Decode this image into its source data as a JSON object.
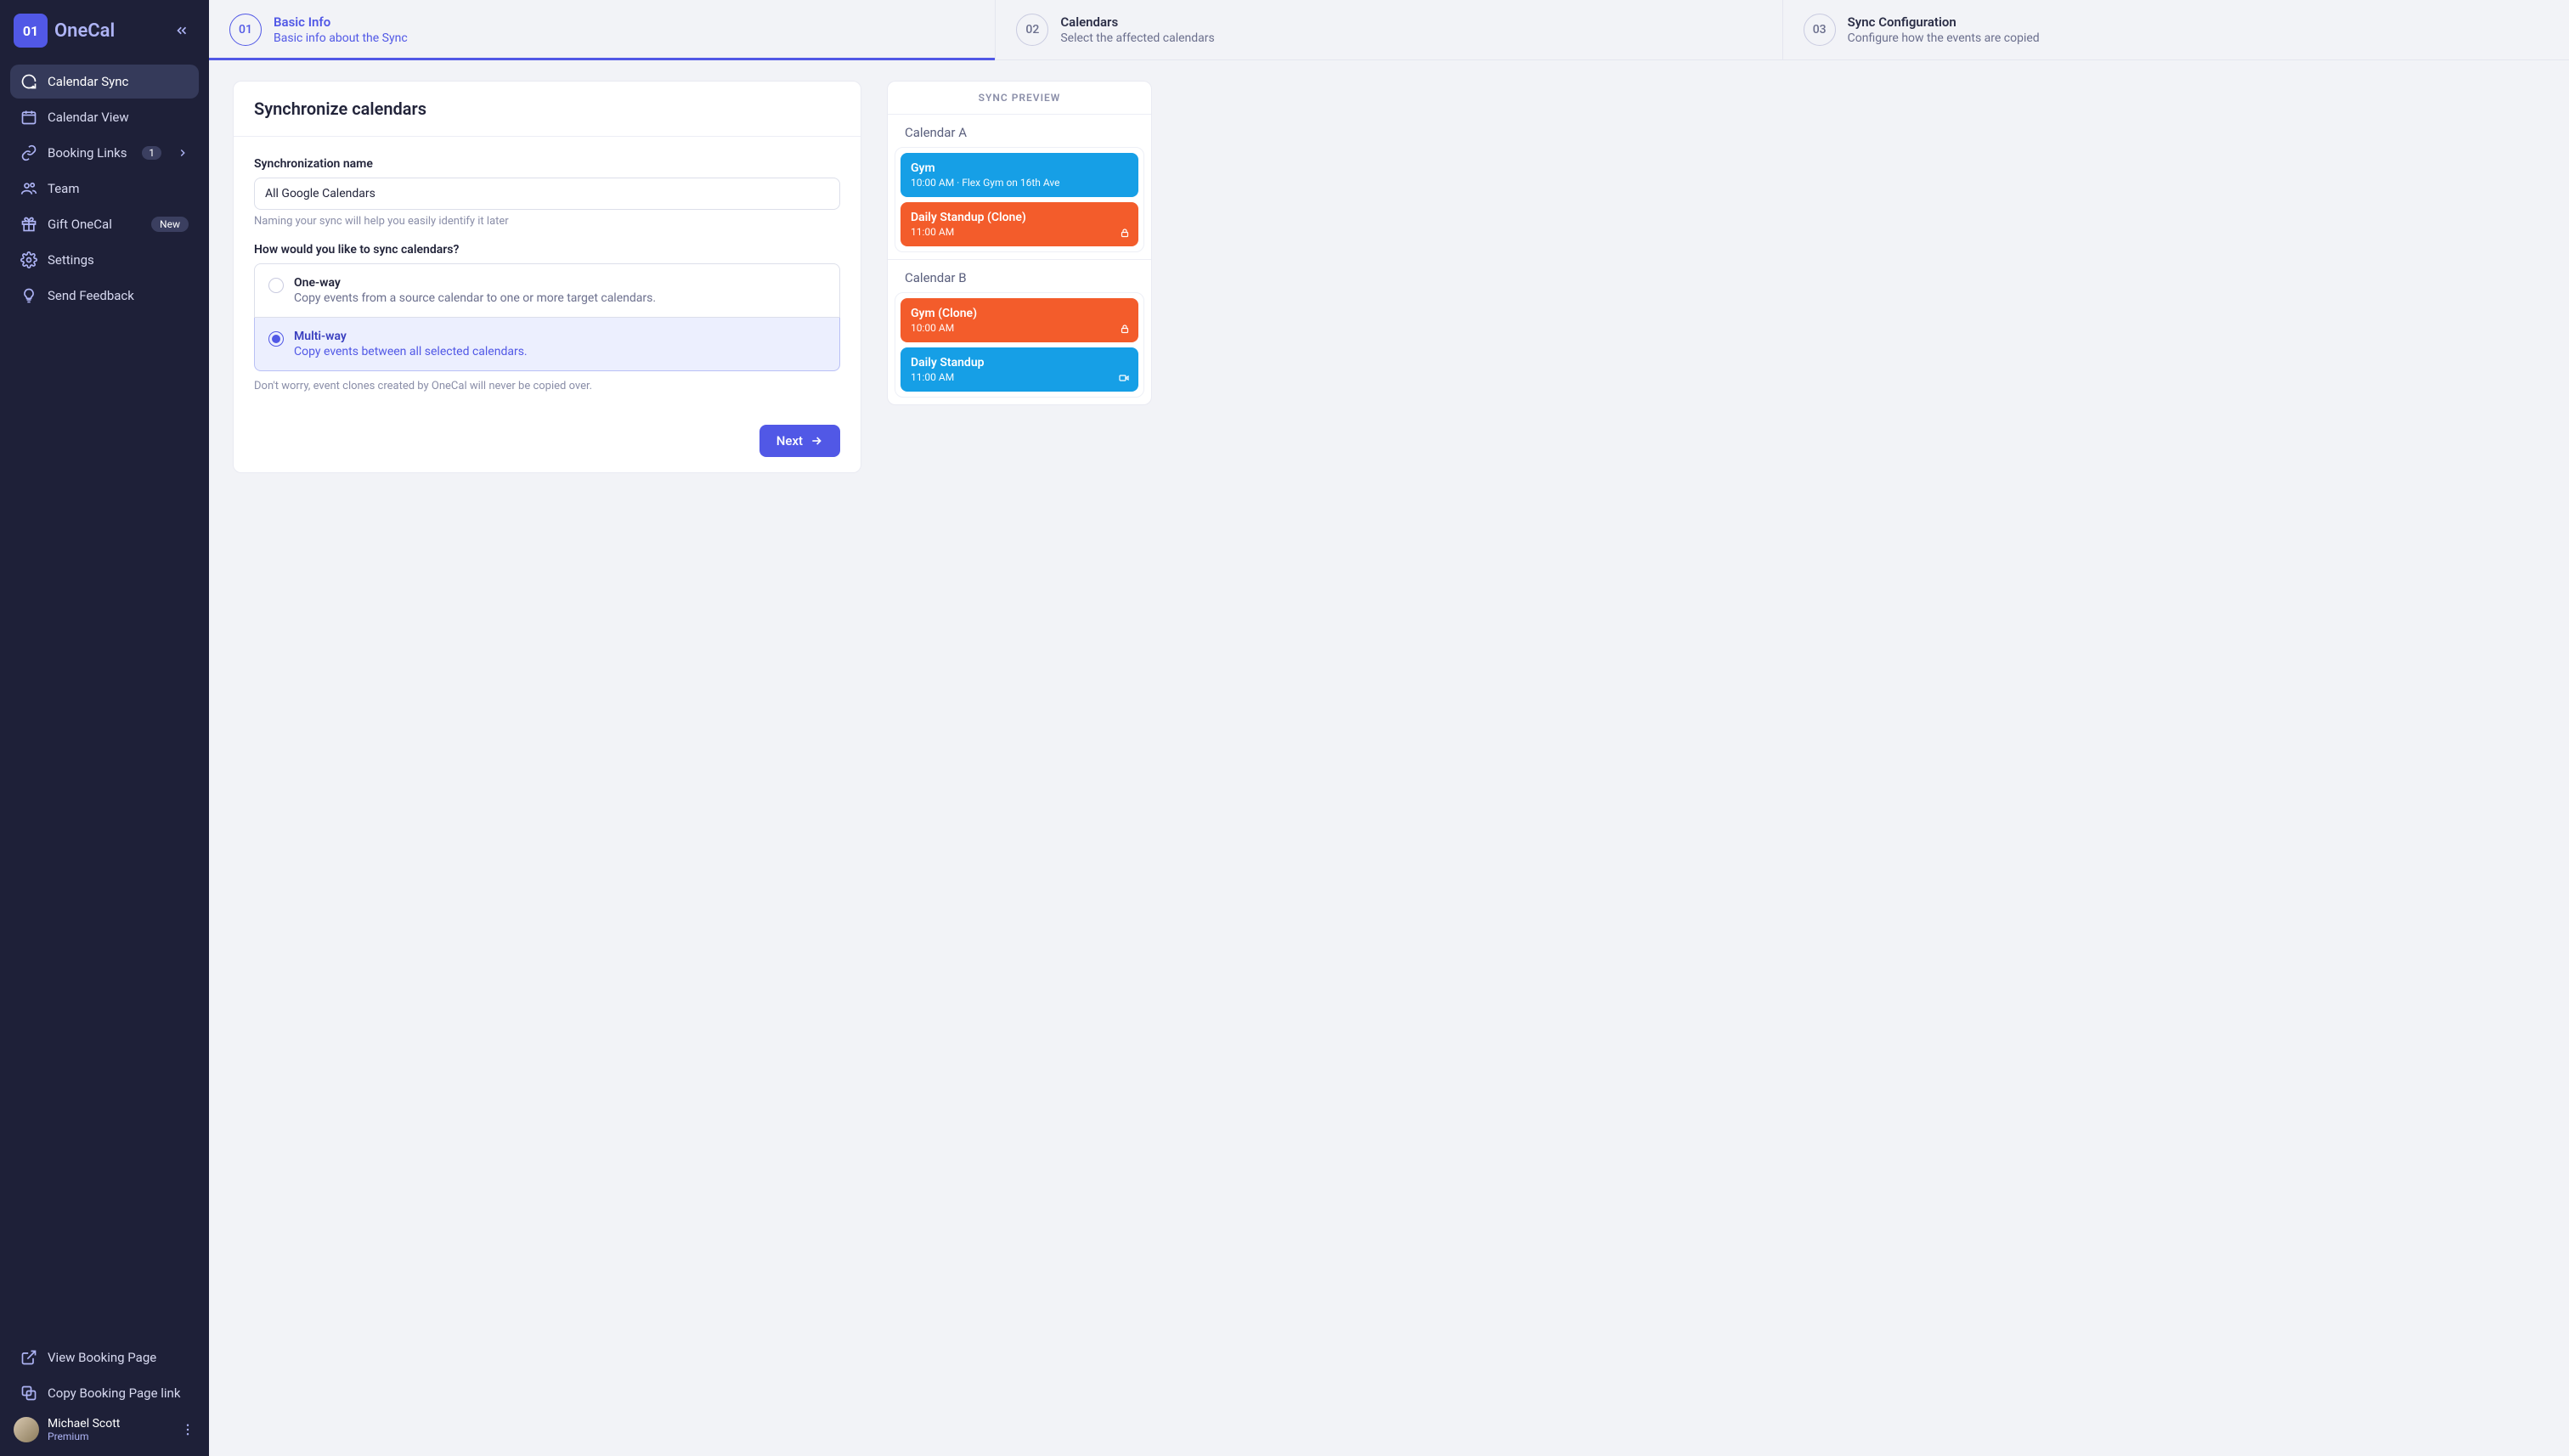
{
  "brand": {
    "badge": "01",
    "name": "OneCal"
  },
  "sidebar": {
    "items": [
      {
        "label": "Calendar Sync"
      },
      {
        "label": "Calendar View"
      },
      {
        "label": "Booking Links",
        "count": "1"
      },
      {
        "label": "Team"
      },
      {
        "label": "Gift OneCal",
        "badge": "New"
      },
      {
        "label": "Settings"
      },
      {
        "label": "Send Feedback"
      }
    ],
    "bottom": [
      {
        "label": "View Booking Page"
      },
      {
        "label": "Copy Booking Page link"
      }
    ]
  },
  "user": {
    "name": "Michael Scott",
    "plan": "Premium"
  },
  "stepper": [
    {
      "num": "01",
      "title": "Basic Info",
      "sub": "Basic info about the Sync"
    },
    {
      "num": "02",
      "title": "Calendars",
      "sub": "Select the affected calendars"
    },
    {
      "num": "03",
      "title": "Sync Configuration",
      "sub": "Configure how the events are copied"
    }
  ],
  "form": {
    "heading": "Synchronize calendars",
    "name_label": "Synchronization name",
    "name_value": "All Google Calendars",
    "name_help": "Naming your sync will help you easily identify it later",
    "method_label": "How would you like to sync calendars?",
    "options": [
      {
        "title": "One-way",
        "sub": "Copy events from a source calendar to one or more target calendars."
      },
      {
        "title": "Multi-way",
        "sub": "Copy events between all selected calendars."
      }
    ],
    "note": "Don't worry, event clones created by OneCal will never be copied over.",
    "next": "Next"
  },
  "preview": {
    "title": "SYNC PREVIEW",
    "calA": "Calendar A",
    "calB": "Calendar B",
    "a_events": [
      {
        "title": "Gym",
        "sub": "10:00 AM · Flex Gym on 16th Ave",
        "color": "blue"
      },
      {
        "title": "Daily Standup (Clone)",
        "sub": "11:00 AM",
        "color": "orange",
        "icon": "lock"
      }
    ],
    "b_events": [
      {
        "title": "Gym (Clone)",
        "sub": "10:00 AM",
        "color": "orange",
        "icon": "lock"
      },
      {
        "title": "Daily Standup",
        "sub": "11:00 AM",
        "color": "blue",
        "icon": "video"
      }
    ]
  }
}
